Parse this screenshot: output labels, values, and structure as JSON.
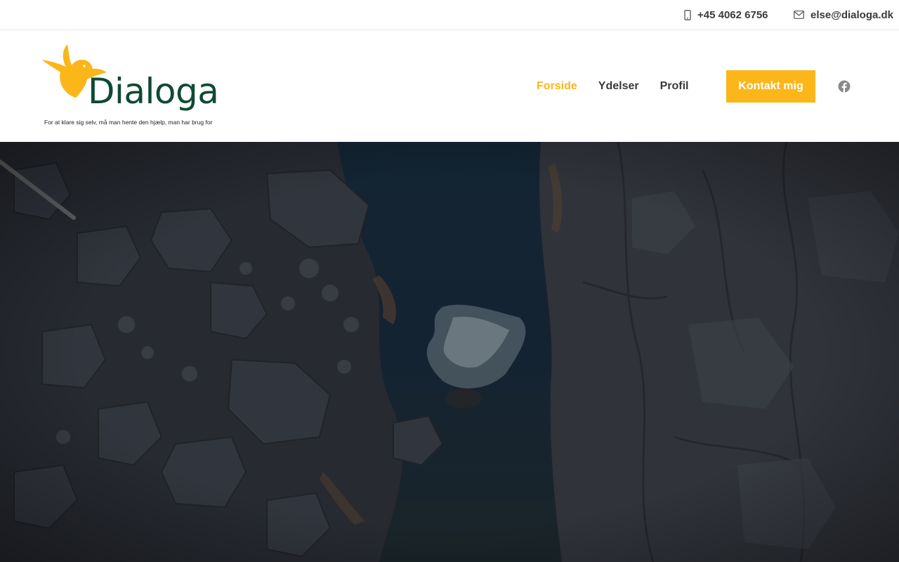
{
  "topbar": {
    "phone": "+45 4062 6756",
    "phone_icon": "mobile-phone-icon",
    "email": "else@dialoga.dk",
    "email_icon": "envelope-icon"
  },
  "logo": {
    "name": "Dialoga",
    "tagline": "For at klare sig selv, må man hente den hjælp, man har brug for",
    "icon": "bird-icon",
    "colors": {
      "bird": "#fbb61a",
      "wordmark": "#0f4a33"
    }
  },
  "nav": {
    "items": [
      {
        "label": "Forside",
        "active": true
      },
      {
        "label": "Ydelser",
        "active": false
      },
      {
        "label": "Profil",
        "active": false
      }
    ]
  },
  "cta": {
    "label": "Kontakt mig"
  },
  "social": {
    "facebook_icon": "facebook-icon"
  },
  "colors": {
    "accent": "#fbb61a",
    "text": "#3a3a3a",
    "hero_overlay": "#1b1d24"
  }
}
